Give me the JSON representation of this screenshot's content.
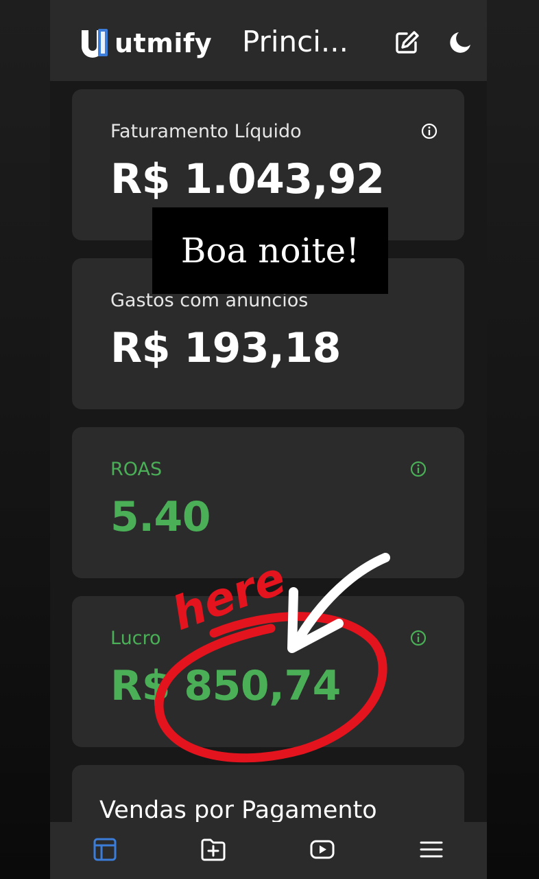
{
  "header": {
    "logo_text": "utmify",
    "title": "Princi...",
    "icons": [
      "edit-icon",
      "moon-icon"
    ]
  },
  "cards": [
    {
      "label": "Faturamento Líquido",
      "value": "R$ 1.043,92",
      "info_icon": true
    },
    {
      "label": "Gastos com anuncios",
      "value": "R$ 193,18",
      "info_icon": false
    },
    {
      "label": "ROAS",
      "value": "5.40",
      "info_icon": true,
      "accent": "#4aaf57"
    },
    {
      "label": "Lucro",
      "value": "R$ 850,74",
      "info_icon": true,
      "accent": "#4aaf57"
    },
    {
      "title": "Vendas por Pagamento"
    }
  ],
  "overlay": {
    "caption": "Boa noite!",
    "handwriting": "here",
    "handwriting_color": "#e3141e",
    "arrow_color": "#ffffff"
  },
  "bottom_nav": {
    "items": [
      "dashboard-icon",
      "folder-add-icon",
      "video-icon",
      "menu-icon"
    ],
    "active_color": "#3b7dd8"
  },
  "colors": {
    "background": "#181818",
    "card": "#2b2b2b",
    "accent_green": "#4aaf57"
  }
}
